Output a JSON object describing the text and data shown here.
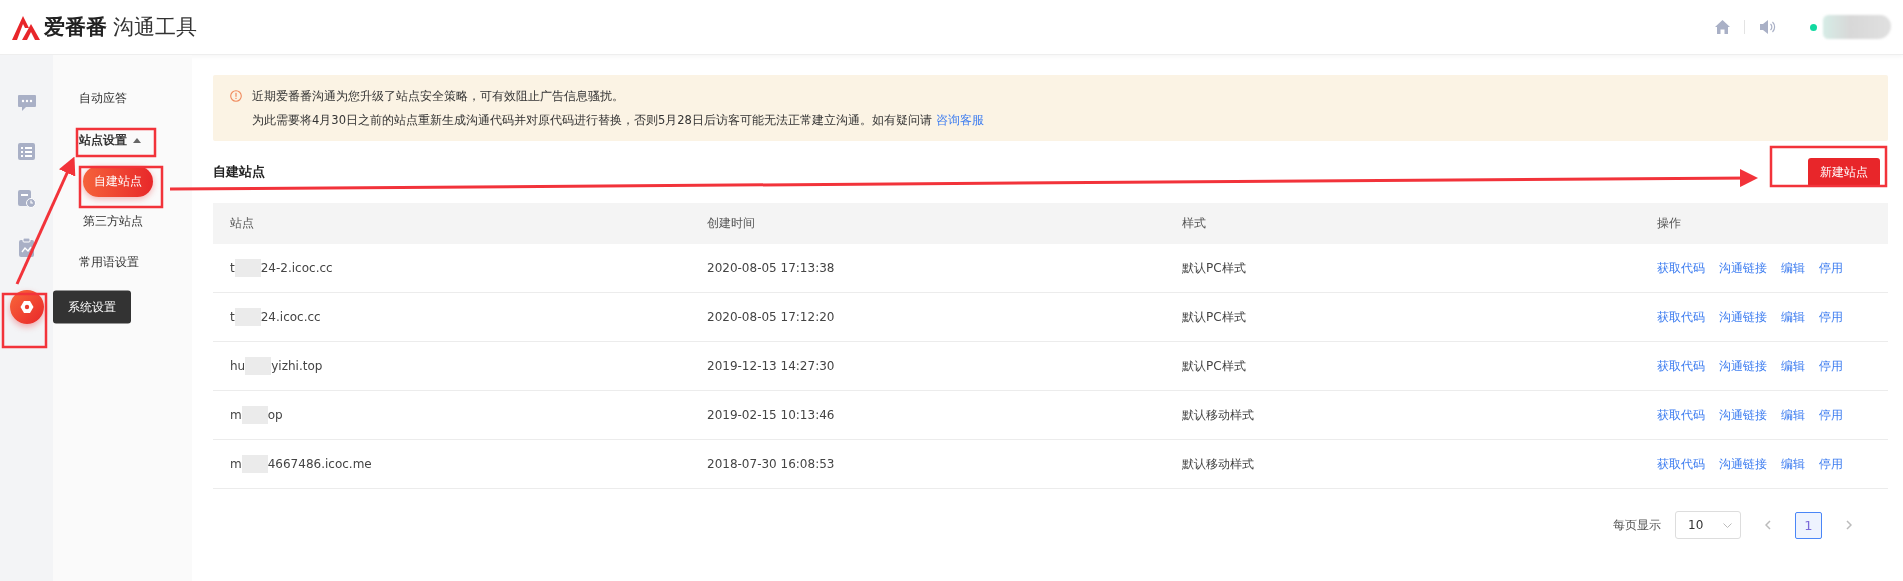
{
  "header": {
    "brand": "爱番番",
    "product": "沟通工具",
    "online": true
  },
  "rail": [
    {
      "kind": "chat",
      "selected": false
    },
    {
      "kind": "list",
      "selected": false
    },
    {
      "kind": "report",
      "selected": false
    },
    {
      "kind": "clipboard",
      "selected": false
    },
    {
      "kind": "settings",
      "selected": true,
      "tooltip": "系统设置"
    }
  ],
  "menu": [
    {
      "label": "自动应答",
      "selected": false
    },
    {
      "label": "站点设置",
      "selected": false,
      "expanded": true,
      "children": [
        {
          "label": "自建站点",
          "selected": true
        },
        {
          "label": "第三方站点",
          "selected": false
        }
      ]
    },
    {
      "label": "常用语设置",
      "selected": false
    }
  ],
  "notice": {
    "line1": "近期爱番番沟通为您升级了站点安全策略，可有效阻止广告信息骚扰。",
    "line2": "为此需要将4月30日之前的站点重新生成沟通代码并对原代码进行替换，否则5月28日后访客可能无法正常建立沟通。如有疑问请",
    "link": "咨询客服"
  },
  "section": {
    "title": "自建站点",
    "new_button": "新建站点"
  },
  "table": {
    "columns": [
      "站点",
      "创建时间",
      "样式",
      "操作"
    ],
    "rows": [
      {
        "site_start": "t",
        "site_end": "24-2.icoc.cc",
        "created": "2020-08-05 17:13:38",
        "style": "默认PC样式",
        "actions": [
          "获取代码",
          "沟通链接",
          "编辑",
          "停用"
        ]
      },
      {
        "site_start": "t",
        "site_end": "24.icoc.cc",
        "created": "2020-08-05 17:12:20",
        "style": "默认PC样式",
        "actions": [
          "获取代码",
          "沟通链接",
          "编辑",
          "停用"
        ]
      },
      {
        "site_start": "hu",
        "site_end": "yizhi.top",
        "created": "2019-12-13 14:27:30",
        "style": "默认PC样式",
        "actions": [
          "获取代码",
          "沟通链接",
          "编辑",
          "停用"
        ]
      },
      {
        "site_start": "m",
        "site_end": "op",
        "created": "2019-02-15 10:13:46",
        "style": "默认移动样式",
        "actions": [
          "获取代码",
          "沟通链接",
          "编辑",
          "停用"
        ]
      },
      {
        "site_start": "m",
        "site_end": "4667486.icoc.me",
        "created": "2018-07-30 16:08:53",
        "style": "默认移动样式",
        "actions": [
          "获取代码",
          "沟通链接",
          "编辑",
          "停用"
        ]
      }
    ]
  },
  "pagination": {
    "per_page_label": "每页显示",
    "per_page": "10",
    "pages": [
      {
        "label": "1",
        "selected": true
      }
    ]
  }
}
